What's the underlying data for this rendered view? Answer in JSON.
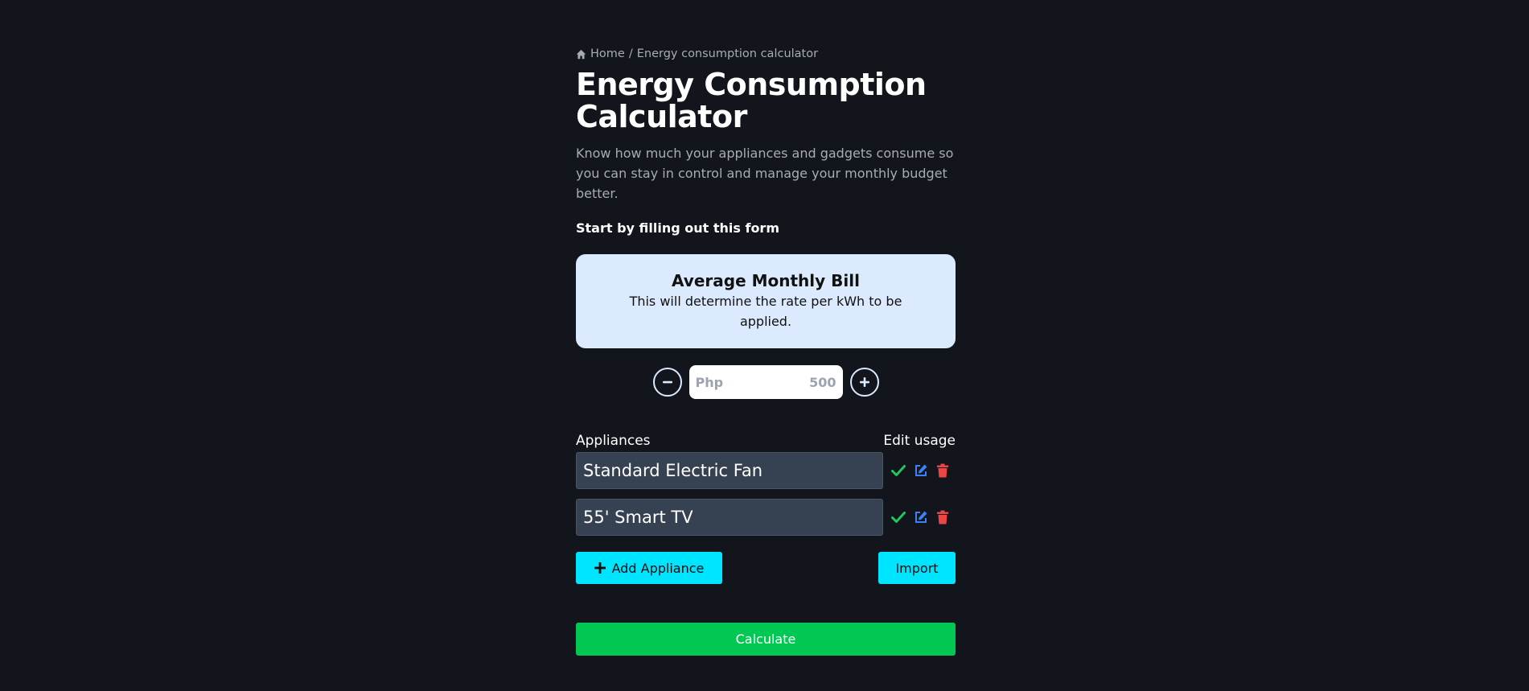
{
  "breadcrumb": {
    "home": "Home",
    "separator": "/",
    "current": "Energy consumption calculator",
    "icon": "home-icon"
  },
  "page": {
    "title_line1": "Energy Consumption",
    "title_line2": "Calculator",
    "subtitle": "Know how much your appliances and gadgets consume so you can stay in control and manage your monthly budget better."
  },
  "form": {
    "heading": "Start by filling out this form",
    "bill_card": {
      "title": "Average Monthly Bill",
      "description": "This will determine the rate per kWh to be applied."
    },
    "bill_input": {
      "currency": "Php",
      "placeholder": "500"
    },
    "minus_icon": "minus-circle-icon",
    "plus_icon": "plus-circle-icon"
  },
  "appliances": {
    "header_label": "Appliances",
    "edit_label": "Edit usage",
    "items": [
      {
        "name": "Standard Electric Fan"
      },
      {
        "name": "55' Smart TV"
      }
    ],
    "action_icons": [
      "check-icon",
      "edit-icon",
      "trash-icon"
    ]
  },
  "buttons": {
    "add": "Add Appliance",
    "import": "Import",
    "calculate": "Calculate"
  },
  "colors": {
    "background": "#12161c",
    "accent_cyan": "#00e5ff",
    "calculate_green": "#00c853",
    "card_blue": "#dbeafe",
    "check_green": "#22c55e",
    "edit_blue": "#3b82f6",
    "trash_red": "#ef4444"
  }
}
